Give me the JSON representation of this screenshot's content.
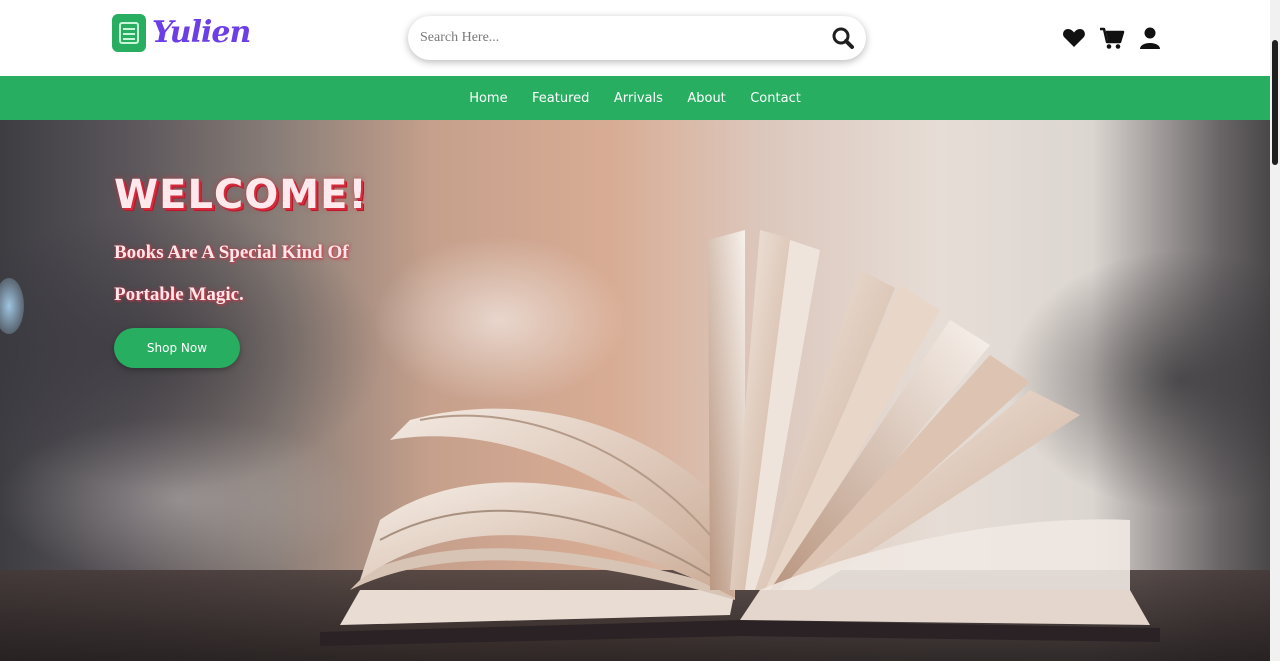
{
  "brand": {
    "name": "Yulien",
    "accent": "#27ae60",
    "logo_text_color": "#6c3fe6"
  },
  "search": {
    "placeholder": "Search Here...",
    "icon": "search-icon"
  },
  "header_icons": [
    {
      "name": "heart-icon"
    },
    {
      "name": "cart-icon"
    },
    {
      "name": "user-icon"
    }
  ],
  "nav": {
    "items": [
      {
        "label": "Home"
      },
      {
        "label": "Featured"
      },
      {
        "label": "Arrivals"
      },
      {
        "label": "About"
      },
      {
        "label": "Contact"
      }
    ]
  },
  "hero": {
    "heading": "WELCOME!",
    "tagline_line1": "Books Are A Special Kind Of",
    "tagline_line2": "Portable Magic.",
    "button": "Shop Now",
    "heading_color": "#d62b3c"
  }
}
